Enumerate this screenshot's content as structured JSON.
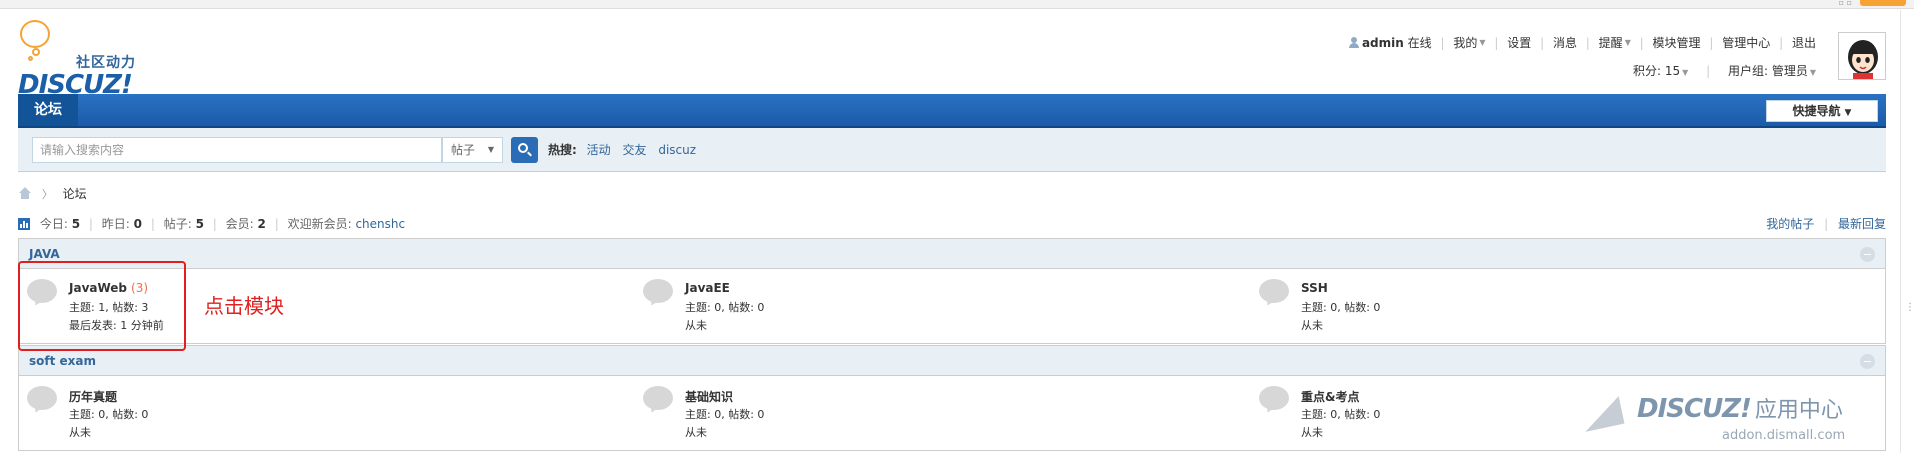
{
  "site": {
    "tagline": "社区动力",
    "wordmark": "DISCUZ!"
  },
  "user_nav": {
    "username": "admin",
    "status": "在线",
    "my": "我的",
    "settings": "设置",
    "messages": "消息",
    "reminders": "提醒",
    "module_mgmt": "模块管理",
    "admin_center": "管理中心",
    "logout": "退出",
    "points": "积分: 15",
    "usergroup": "用户组: 管理员"
  },
  "nav": {
    "forum_tab": "论坛",
    "quick_nav": "快捷导航"
  },
  "search": {
    "placeholder": "请输入搜索内容",
    "type": "帖子",
    "hot_label": "热搜:",
    "hot": [
      "活动",
      "交友",
      "discuz"
    ]
  },
  "breadcrumb": {
    "current": "论坛"
  },
  "stats": {
    "today_label": "今日:",
    "today": "5",
    "yesterday_label": "昨日:",
    "yesterday": "0",
    "posts_label": "帖子:",
    "posts": "5",
    "members_label": "会员:",
    "members": "2",
    "welcome_label": "欢迎新会员:",
    "newest": "chenshc",
    "my_posts": "我的帖子",
    "latest_replies": "最新回复"
  },
  "categories": [
    {
      "name": "JAVA",
      "forums": [
        {
          "title": "JavaWeb",
          "new_count": "(3)",
          "stats": "主题: 1, 帖数: 3",
          "last": "最后发表: 1 分钟前"
        },
        {
          "title": "JavaEE",
          "new_count": "",
          "stats": "主题: 0, 帖数: 0",
          "last": "从未"
        },
        {
          "title": "SSH",
          "new_count": "",
          "stats": "主题: 0, 帖数: 0",
          "last": "从未"
        }
      ]
    },
    {
      "name": "soft exam",
      "forums": [
        {
          "title": "历年真题",
          "new_count": "",
          "stats": "主题: 0, 帖数: 0",
          "last": "从未"
        },
        {
          "title": "基础知识",
          "new_count": "",
          "stats": "主题: 0, 帖数: 0",
          "last": "从未"
        },
        {
          "title": "重点&考点",
          "new_count": "",
          "stats": "主题: 0, 帖数: 0",
          "last": "从未"
        }
      ]
    }
  ],
  "annotation": "点击模块",
  "watermark": {
    "logo": "DISCUZ!",
    "cn": "应用中心",
    "url": "addon.dismall.com"
  },
  "colors": {
    "accent": "#2a6cb6",
    "link": "#336699",
    "annotation": "#e02020"
  }
}
